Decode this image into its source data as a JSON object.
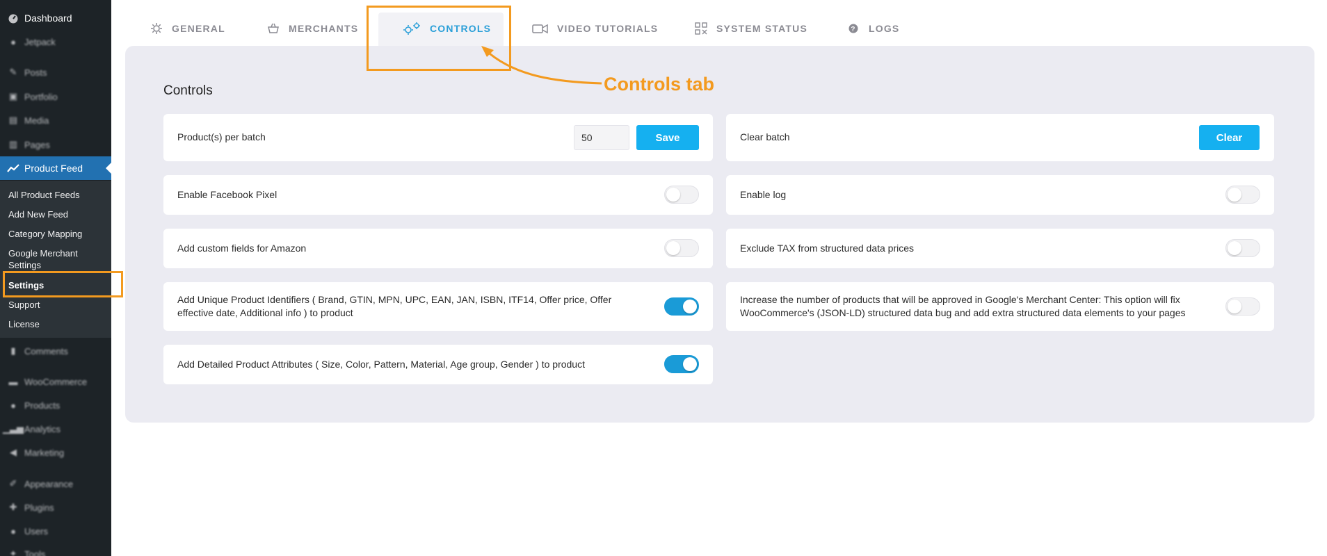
{
  "sidebar": {
    "dashboard": "Dashboard",
    "items_top": [
      "Jetpack",
      "Posts",
      "Portfolio",
      "Media",
      "Pages"
    ],
    "active": "Product Feed",
    "submenu": [
      "All Product Feeds",
      "Add New Feed",
      "Category Mapping",
      "Google Merchant Settings",
      "Settings",
      "Support",
      "License"
    ],
    "current_sub": "Settings",
    "items_bottom": [
      "Comments",
      "WooCommerce",
      "Products",
      "Analytics",
      "Marketing",
      "Appearance",
      "Plugins",
      "Users",
      "Tools"
    ]
  },
  "tabs": [
    {
      "label": "GENERAL",
      "icon": "gear-icon"
    },
    {
      "label": "MERCHANTS",
      "icon": "basket-icon"
    },
    {
      "label": "CONTROLS",
      "icon": "gears-icon"
    },
    {
      "label": "VIDEO TUTORIALS",
      "icon": "video-camera-icon"
    },
    {
      "label": "SYSTEM STATUS",
      "icon": "system-status-icon"
    },
    {
      "label": "LOGS",
      "icon": "question-circle-icon"
    }
  ],
  "active_tab": "CONTROLS",
  "panel": {
    "title": "Controls",
    "batch": {
      "label": "Product(s) per batch",
      "value": "50",
      "save_label": "Save"
    },
    "clear_batch": {
      "label": "Clear batch",
      "button_label": "Clear"
    },
    "settings_left": [
      {
        "label": "Enable Facebook Pixel",
        "enabled": false
      },
      {
        "label": "Add custom fields for Amazon",
        "enabled": false
      },
      {
        "label": "Add Unique Product Identifiers ( Brand, GTIN, MPN, UPC, EAN, JAN, ISBN, ITF14, Offer price, Offer effective date, Additional info ) to product",
        "enabled": true
      },
      {
        "label": "Add Detailed Product Attributes ( Size, Color, Pattern, Material, Age group, Gender ) to product",
        "enabled": true
      }
    ],
    "settings_right": [
      {
        "label": "Enable log",
        "enabled": false
      },
      {
        "label": "Exclude TAX from structured data prices",
        "enabled": false
      },
      {
        "label": "Increase the number of products that will be approved in Google's Merchant Center: This option will fix WooCommerce's (JSON-LD) structured data bug and add extra structured data elements to your pages",
        "enabled": false
      }
    ]
  },
  "annotation": {
    "text": "Controls tab"
  },
  "colors": {
    "accent": "#1a9bd7",
    "highlight": "#f39a1f",
    "sidebar": "#1d2327",
    "active_menu": "#2271b1"
  }
}
